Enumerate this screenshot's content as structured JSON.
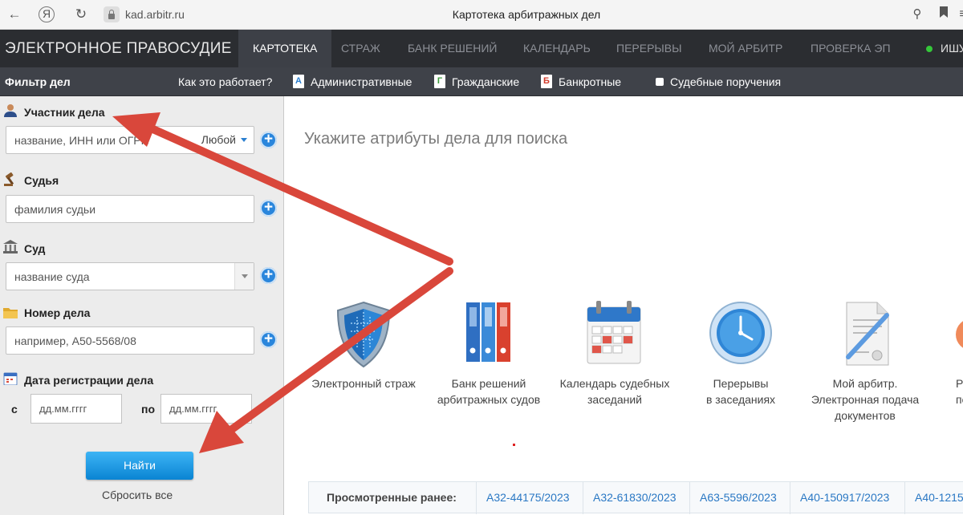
{
  "browser": {
    "back_icon": "arrow-left-icon",
    "ya_label": "Я",
    "reload_icon": "reload-icon",
    "url": "kad.arbitr.ru",
    "title": "Картотека арбитражных дел"
  },
  "nav": {
    "brand": "ЭЛЕКТРОННОЕ ПРАВОСУДИЕ",
    "items": [
      "КАРТОТЕКА",
      "СТРАЖ",
      "БАНК РЕШЕНИЙ",
      "КАЛЕНДАРЬ",
      "ПЕРЕРЫВЫ",
      "МОЙ АРБИТР",
      "ПРОВЕРКА ЭП"
    ],
    "user": "ИШУ",
    "status_color": "#35c73a"
  },
  "filterbar": {
    "title": "Фильтр дел",
    "how": "Как это работает?",
    "categories": [
      {
        "letter": "А",
        "label": "Административные",
        "color": "#2a7fd0"
      },
      {
        "letter": "Г",
        "label": "Гражданские",
        "color": "#3a9a3a"
      },
      {
        "letter": "Б",
        "label": "Банкротные",
        "color": "#d23a2a"
      }
    ],
    "court_orders": "Судебные поручения"
  },
  "sidebar": {
    "participant": {
      "label": "Участник дела",
      "placeholder": "название, ИНН или ОГРН",
      "type_value": "Любой"
    },
    "judge": {
      "label": "Судья",
      "placeholder": "фамилия судьи"
    },
    "court": {
      "label": "Суд",
      "placeholder": "название суда"
    },
    "case_number": {
      "label": "Номер дела",
      "placeholder": "например, А50-5568/08"
    },
    "date": {
      "label": "Дата регистрации дела",
      "from": "с",
      "to": "по",
      "placeholder": "дд.мм.гггг"
    },
    "find": "Найти",
    "reset": "Сбросить все"
  },
  "main": {
    "title": "Укажите атрибуты дела для поиска",
    "tiles": [
      {
        "icon": "shield-icon",
        "line1": "Электронный страж",
        "line2": "",
        "line3": ""
      },
      {
        "icon": "binders-icon",
        "line1": "Банк решений",
        "line2": "арбитражных судов",
        "line3": ""
      },
      {
        "icon": "calendar-icon",
        "line1": "Календарь судебных",
        "line2": "заседаний",
        "line3": ""
      },
      {
        "icon": "clock-icon",
        "line1": "Перерывы",
        "line2": "в заседаниях",
        "line3": ""
      },
      {
        "icon": "document-pen-icon",
        "line1": "Мой арбитр.",
        "line2": "Электронная подача",
        "line3": "документов"
      },
      {
        "icon": "partial-icon",
        "line1": "Р",
        "line2": "по и",
        "line3": ""
      }
    ],
    "recent": {
      "label": "Просмотренные ранее:",
      "cases": [
        "А32-44175/2023",
        "А32-61830/2023",
        "А63-5596/2023",
        "А40-150917/2023",
        "А40-1215"
      ]
    }
  },
  "annotation_color": "#d9473b"
}
